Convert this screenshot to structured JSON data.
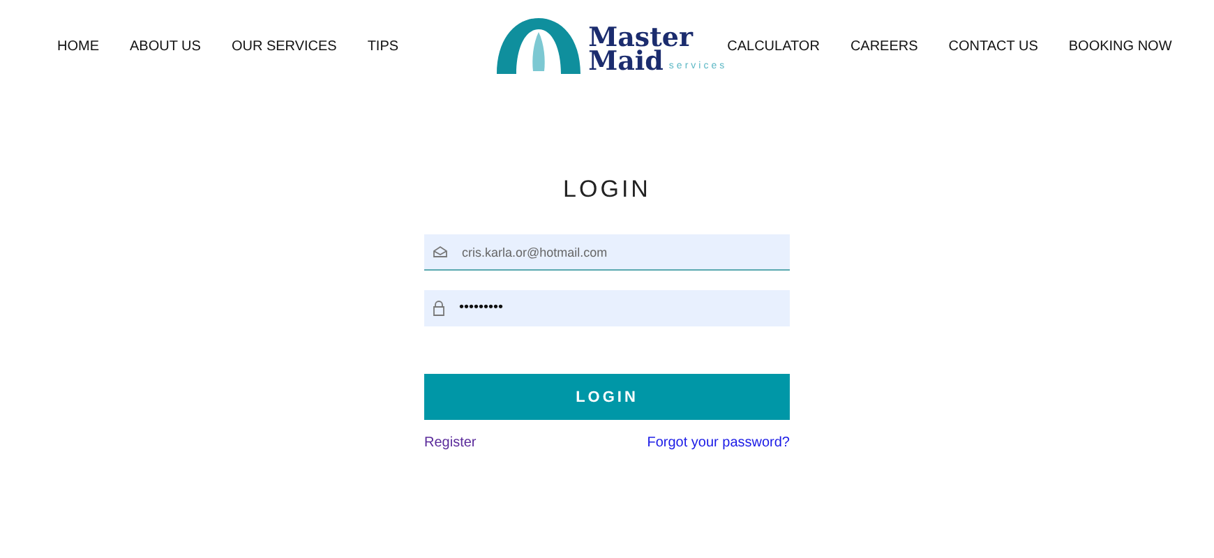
{
  "nav_left": [
    "HOME",
    "ABOUT US",
    "OUR SERVICES",
    "TIPS"
  ],
  "logo": {
    "line_1": "Master",
    "line_2": "Maid",
    "tagline": "services"
  },
  "nav_right": [
    "CALCULATOR",
    "CAREERS",
    "CONTACT US",
    "BOOKING NOW"
  ],
  "login": {
    "title": "LOGIN",
    "fields": [
      {
        "kind": "email",
        "value": "cris.karla.or@hotmail.com",
        "focused": true
      },
      {
        "kind": "password",
        "value": "•••••••••",
        "focused": false
      }
    ],
    "button": "LOGIN",
    "register_link": "Register",
    "forgot_link": "Forgot your password?"
  }
}
